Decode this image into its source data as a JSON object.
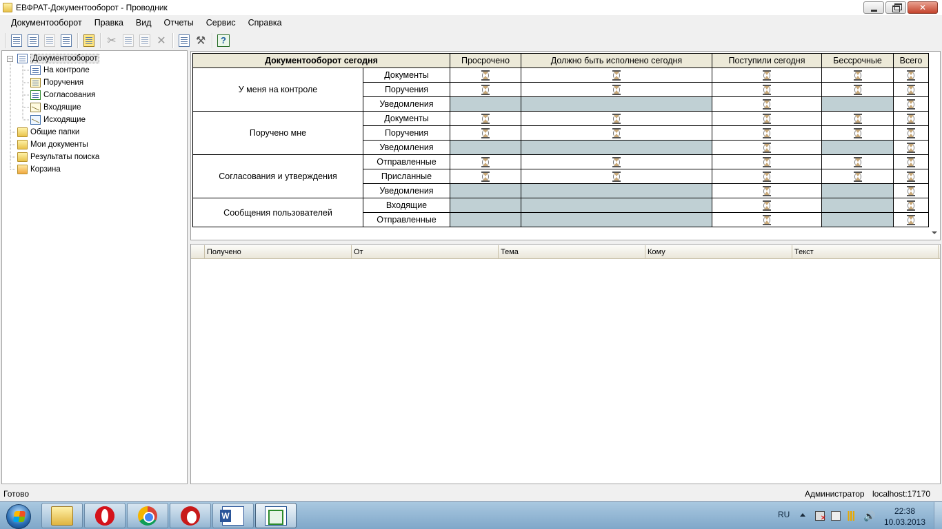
{
  "window": {
    "title": "ЕВФРАТ-Документооборот - Проводник"
  },
  "menu": [
    "Документооборот",
    "Правка",
    "Вид",
    "Отчеты",
    "Сервис",
    "Справка"
  ],
  "tree": {
    "root": "Документооборот",
    "children": [
      "На контроле",
      "Поручения",
      "Согласования",
      "Входящие",
      "Исходящие"
    ],
    "siblings": [
      "Общие папки",
      "Мои документы",
      "Результаты поиска",
      "Корзина"
    ]
  },
  "dashboard": {
    "title": "Документооборот сегодня",
    "columns": [
      "Просрочено",
      "Должно быть исполнено сегодня",
      "Поступили сегодня",
      "Бессрочные",
      "Всего"
    ],
    "groups": [
      {
        "name": "У меня на контроле",
        "rows": [
          "Документы",
          "Поручения",
          "Уведомления"
        ]
      },
      {
        "name": "Поручено мне",
        "rows": [
          "Документы",
          "Поручения",
          "Уведомления"
        ]
      },
      {
        "name": "Согласования и утверждения",
        "rows": [
          "Отправленные",
          "Присланные",
          "Уведомления"
        ]
      },
      {
        "name": "Сообщения пользователей",
        "rows": [
          "Входящие",
          "Отправленные"
        ]
      }
    ]
  },
  "list": {
    "columns": [
      "Получено",
      "От",
      "Тема",
      "Кому",
      "Текст"
    ]
  },
  "status": {
    "left": "Готово",
    "user": "Администратор",
    "host": "localhost:17170"
  },
  "taskbar": {
    "lang": "RU",
    "time": "22:38",
    "date": "10.03.2013",
    "apps": [
      "explorer",
      "opera",
      "chrome",
      "opera-next",
      "word",
      "evfrat"
    ]
  }
}
